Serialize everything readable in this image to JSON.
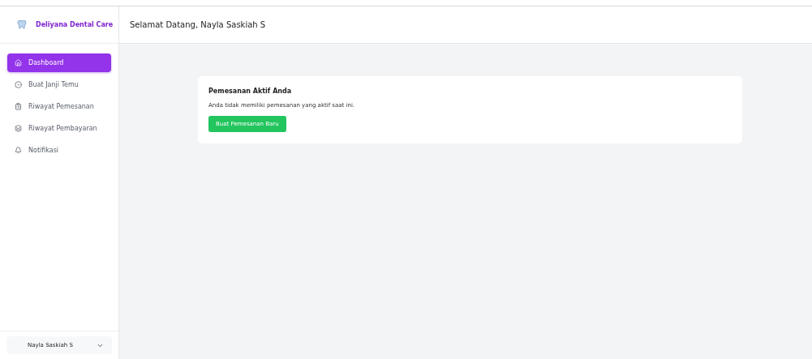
{
  "brand": {
    "name": "Deliyana Dental Care"
  },
  "header": {
    "greeting": "Selamat Datang, Nayla Saskiah S"
  },
  "sidebar": {
    "items": [
      {
        "label": "Dashboard",
        "selected": true
      },
      {
        "label": "Buat Janji Temu",
        "selected": false
      },
      {
        "label": "Riwayat Pemesanan",
        "selected": false
      },
      {
        "label": "Riwayat Pembayaran",
        "selected": false
      },
      {
        "label": "Notifikasi",
        "selected": false
      }
    ]
  },
  "user": {
    "name": "Nayla Saskiah S"
  },
  "card": {
    "title": "Pemesanan Aktif Anda",
    "message": "Anda tidak memiliki pemesanan yang aktif saat ini.",
    "button": "Buat Pemesanan Baru"
  }
}
